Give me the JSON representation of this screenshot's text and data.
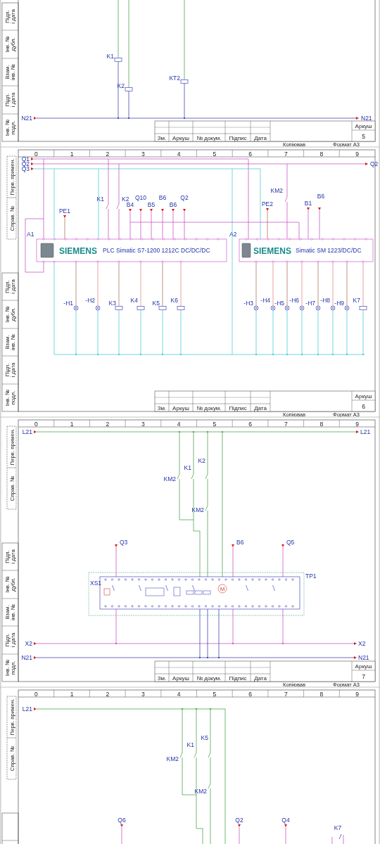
{
  "pages": [
    {
      "kind": "relay",
      "side_box": [
        "Підп. і дата",
        "Інв. № дубл.",
        "Взам. інв. №",
        "Підп. і дата",
        "Інв. № подл."
      ],
      "wire_labels": [
        "N21",
        "N21"
      ],
      "devices": [
        {
          "label": "K1",
          "kind": "coil"
        },
        {
          "label": "K2",
          "kind": "coil"
        },
        {
          "label": "KT2",
          "kind": "coil"
        }
      ],
      "title_block": {
        "headers": [
          "Зм.",
          "Аркуш",
          "№ докум.",
          "Підпис",
          "Дата"
        ],
        "sheet_label": "Аркуш",
        "sheet_number": "5"
      },
      "footer": [
        "Копіював",
        "Формат А3"
      ]
    },
    {
      "kind": "plc",
      "columns": [
        "0",
        "1",
        "2",
        "3",
        "4",
        "5",
        "6",
        "7",
        "8",
        "9"
      ],
      "top_box": [
        "Перв. примен.",
        "Справ. №"
      ],
      "side_box": [
        "Підп. і дата",
        "Інв. № дубл.",
        "Взам. інв. №",
        "Підп. і дата",
        "Інв. № подл."
      ],
      "wire_labels": [
        "Q1",
        "Q2",
        "Q3",
        "Q2"
      ],
      "inputs": [
        "K1",
        "K2",
        "B4",
        "Q10",
        "B5",
        "B6",
        "B6",
        "Q2",
        "PE1",
        "PE2",
        "KM2",
        "B1",
        "B6"
      ],
      "modules": [
        {
          "tag": "A1",
          "brand": "SIEMENS",
          "title": "PLC Simatic S7-1200 1212C DC/DC/DC"
        },
        {
          "tag": "A2",
          "brand": "SIEMENS",
          "title": "Simatic SM 1223/DC/DC"
        }
      ],
      "devices": [
        {
          "label": "-H1",
          "kind": "lamp"
        },
        {
          "label": "-H2",
          "kind": "lamp"
        },
        {
          "label": "K3",
          "kind": "coil"
        },
        {
          "label": "K4",
          "kind": "coil"
        },
        {
          "label": "K5",
          "kind": "coil"
        },
        {
          "label": "K6",
          "kind": "coil"
        },
        {
          "label": "-H3",
          "kind": "lamp"
        },
        {
          "label": "-H4",
          "kind": "lamp"
        },
        {
          "label": "-H5",
          "kind": "lamp"
        },
        {
          "label": "-H6",
          "kind": "lamp"
        },
        {
          "label": "-H7",
          "kind": "lamp"
        },
        {
          "label": "-H8",
          "kind": "lamp"
        },
        {
          "label": "-H9",
          "kind": "lamp"
        },
        {
          "label": "K7",
          "kind": "coil"
        }
      ],
      "title_block": {
        "headers": [
          "Зм.",
          "Аркуш",
          "№ докум.",
          "Підпис",
          "Дата"
        ],
        "sheet_label": "Аркуш",
        "sheet_number": "6"
      },
      "footer": [
        "Копіював",
        "Формат А3"
      ]
    },
    {
      "kind": "terminal",
      "columns": [
        "0",
        "1",
        "2",
        "3",
        "4",
        "5",
        "6",
        "7",
        "8",
        "9"
      ],
      "top_box": [
        "Перв. примен.",
        "Справ. №"
      ],
      "side_box": [
        "Підп. і дата",
        "Інв. № дубл.",
        "Взам. інв. №",
        "Підп. і дата",
        "Інв. № подл."
      ],
      "wire_labels": [
        "L21",
        "L21",
        "X2",
        "X2",
        "N21",
        "N21"
      ],
      "inputs": [
        "KM2",
        "K1",
        "K2",
        "KM2",
        "Q3",
        "B6",
        "Q5"
      ],
      "block": {
        "tag": "XS1",
        "frame": "TP1",
        "motor": "M"
      },
      "title_block": {
        "headers": [
          "Зм.",
          "Аркуш",
          "№ докум.",
          "Підпис",
          "Дата"
        ],
        "sheet_label": "Аркуш",
        "sheet_number": "7"
      },
      "footer": [
        "Копіював",
        "Формат А3"
      ]
    },
    {
      "kind": "terminal_top",
      "columns": [
        "0",
        "1",
        "2",
        "3",
        "4",
        "5",
        "6",
        "7",
        "8",
        "9"
      ],
      "top_box": [
        "Перв. примен.",
        "Справ. №"
      ],
      "wire_labels": [
        "L21"
      ],
      "inputs": [
        "KM2",
        "K1",
        "K5",
        "KM2",
        "Q6",
        "Q2",
        "Q4",
        "K7"
      ]
    }
  ]
}
